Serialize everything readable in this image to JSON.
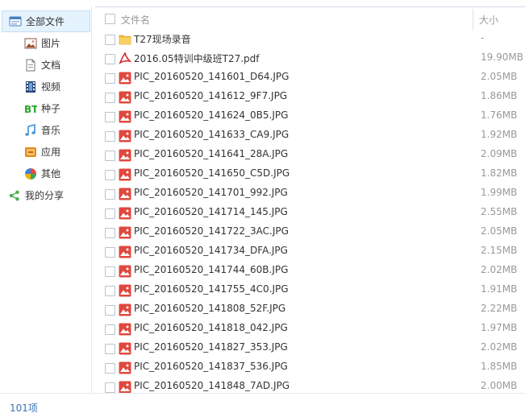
{
  "sidebar": {
    "items": [
      {
        "label": "全部文件",
        "icon": "all-files-icon",
        "selected": true
      },
      {
        "label": "图片",
        "icon": "image-category-icon"
      },
      {
        "label": "文档",
        "icon": "document-category-icon"
      },
      {
        "label": "视频",
        "icon": "video-category-icon"
      },
      {
        "label": "种子",
        "icon": "torrent-category-icon"
      },
      {
        "label": "音乐",
        "icon": "music-category-icon"
      },
      {
        "label": "应用",
        "icon": "app-category-icon"
      },
      {
        "label": "其他",
        "icon": "other-category-icon"
      },
      {
        "label": "我的分享",
        "icon": "share-icon"
      }
    ]
  },
  "file_list": {
    "header": {
      "name": "文件名",
      "size": "大小"
    },
    "rows": [
      {
        "name": "T27现场录音",
        "size": "-",
        "type": "folder"
      },
      {
        "name": "2016.05特训中级班T27.pdf",
        "size": "19.90MB",
        "type": "pdf"
      },
      {
        "name": "PIC_20160520_141601_D64.JPG",
        "size": "2.05MB",
        "type": "image"
      },
      {
        "name": "PIC_20160520_141612_9F7.JPG",
        "size": "1.86MB",
        "type": "image"
      },
      {
        "name": "PIC_20160520_141624_0B5.JPG",
        "size": "1.76MB",
        "type": "image"
      },
      {
        "name": "PIC_20160520_141633_CA9.JPG",
        "size": "1.92MB",
        "type": "image"
      },
      {
        "name": "PIC_20160520_141641_28A.JPG",
        "size": "2.09MB",
        "type": "image"
      },
      {
        "name": "PIC_20160520_141650_C5D.JPG",
        "size": "1.82MB",
        "type": "image"
      },
      {
        "name": "PIC_20160520_141701_992.JPG",
        "size": "1.99MB",
        "type": "image"
      },
      {
        "name": "PIC_20160520_141714_145.JPG",
        "size": "2.55MB",
        "type": "image"
      },
      {
        "name": "PIC_20160520_141722_3AC.JPG",
        "size": "2.05MB",
        "type": "image"
      },
      {
        "name": "PIC_20160520_141734_DFA.JPG",
        "size": "2.15MB",
        "type": "image"
      },
      {
        "name": "PIC_20160520_141744_60B.JPG",
        "size": "2.02MB",
        "type": "image"
      },
      {
        "name": "PIC_20160520_141755_4C0.JPG",
        "size": "1.91MB",
        "type": "image"
      },
      {
        "name": "PIC_20160520_141808_52F.JPG",
        "size": "2.22MB",
        "type": "image"
      },
      {
        "name": "PIC_20160520_141818_042.JPG",
        "size": "1.97MB",
        "type": "image"
      },
      {
        "name": "PIC_20160520_141827_353.JPG",
        "size": "2.02MB",
        "type": "image"
      },
      {
        "name": "PIC_20160520_141837_536.JPG",
        "size": "1.85MB",
        "type": "image"
      },
      {
        "name": "PIC_20160520_141848_7AD.JPG",
        "size": "2.00MB",
        "type": "image"
      }
    ]
  },
  "footer": {
    "count": "101项"
  }
}
